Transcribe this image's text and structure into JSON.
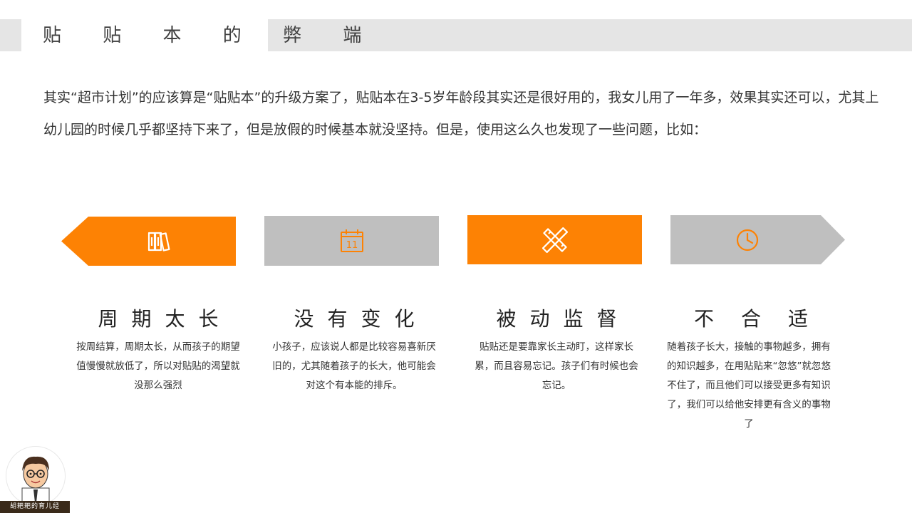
{
  "slide": {
    "title": "贴 贴 本 的 弊 端",
    "intro": "其实“超市计划”的应该算是“贴贴本”的升级方案了，贴贴本在3-5岁年龄段其实还是很好用的，我女儿用了一年多，效果其实还可以，尤其上幼儿园的时候几乎都坚持下来了，但是放假的时候基本就没坚持。但是，使用这么久也发现了一些问题，比如："
  },
  "steps": [
    {
      "icon": "books-icon",
      "color": "#fd8204"
    },
    {
      "icon": "calendar-icon",
      "color": "#bfbfbf",
      "calendar_day": "11"
    },
    {
      "icon": "pencil-ruler-icon",
      "color": "#fd8204"
    },
    {
      "icon": "clock-icon",
      "color": "#bfbfbf"
    }
  ],
  "cards": [
    {
      "heading": "周期太长",
      "body": "按周结算，周期太长，从而孩子的期望值慢慢就放低了，所以对贴贴的渴望就没那么强烈"
    },
    {
      "heading": "没有变化",
      "body": "小孩子，应该说人都是比较容易喜新厌旧的，尤其随着孩子的长大，他可能会对这个有本能的排斥。"
    },
    {
      "heading": "被动监督",
      "body": "贴贴还是要靠家长主动盯，这样家长累，而且容易忘记。孩子们有时候也会忘记。"
    },
    {
      "heading": "不合适",
      "body": "随着孩子长大，接触的事物越多，拥有的知识越多，在用贴贴来“忽悠”就忽悠不住了，而且他们可以接受更多有知识了，我们可以给他安排更有含义的事物了"
    }
  ],
  "footer": {
    "brand": "胡耙耙的育儿经"
  },
  "colors": {
    "accent": "#fd8204",
    "gray": "#bfbfbf",
    "title_band": "#e5e5e5"
  }
}
